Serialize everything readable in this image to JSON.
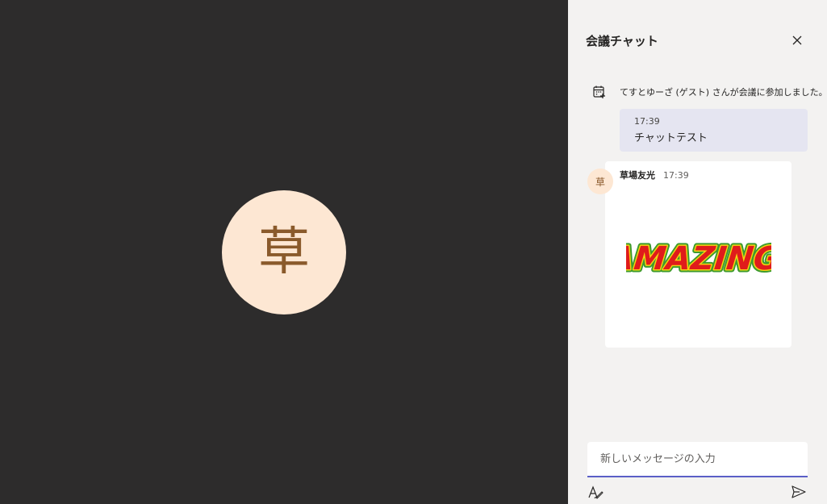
{
  "stage": {
    "avatar_initial": "草"
  },
  "chat_panel": {
    "title": "会議チャット",
    "close_icon": "close-icon",
    "system_message": {
      "icon": "calendar-icon",
      "text": "てすとゆーざ (ゲスト) さんが会議に参加しました。"
    },
    "self_message": {
      "time": "17:39",
      "text": "チャットテスト"
    },
    "incoming_message": {
      "avatar_initial": "草",
      "author": "草場友光",
      "time": "17:39",
      "sticker_text": "AMAZING"
    },
    "compose": {
      "placeholder": "新しいメッセージの入力",
      "format_icon": "format-icon",
      "send_icon": "send-icon"
    }
  },
  "colors": {
    "stage_bg": "#2d2c2c",
    "panel_bg": "#f3f2f1",
    "avatar_bg": "#fde7d3",
    "avatar_fg": "#8a5a2b",
    "self_bubble": "#e5e5f1",
    "accent": "#5b5fc7"
  }
}
